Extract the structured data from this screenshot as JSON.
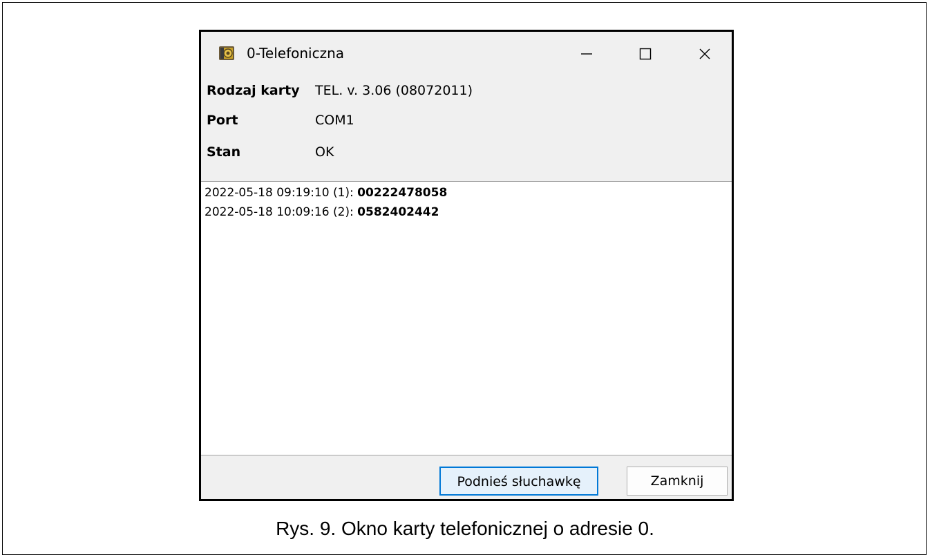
{
  "window": {
    "title": "0-Telefoniczna",
    "icon": "phone-card-icon"
  },
  "info": {
    "card_type_label": "Rodzaj karty",
    "card_type_value": "TEL. v. 3.06 (08072011)",
    "port_label": "Port",
    "port_value": "COM1",
    "status_label": "Stan",
    "status_value": "OK"
  },
  "log": [
    {
      "timestamp": "2022-05-18 09:19:10 (1):",
      "number": "00222478058"
    },
    {
      "timestamp": "2022-05-18 10:09:16 (2):",
      "number": "0582402442"
    }
  ],
  "buttons": {
    "pickup_label": "Podnieś słuchawkę",
    "close_label": "Zamknij"
  },
  "caption": "Rys. 9. Okno karty telefonicznej o adresie 0.",
  "colors": {
    "accent": "#0078d7",
    "window_bg": "#f0f0f0"
  }
}
